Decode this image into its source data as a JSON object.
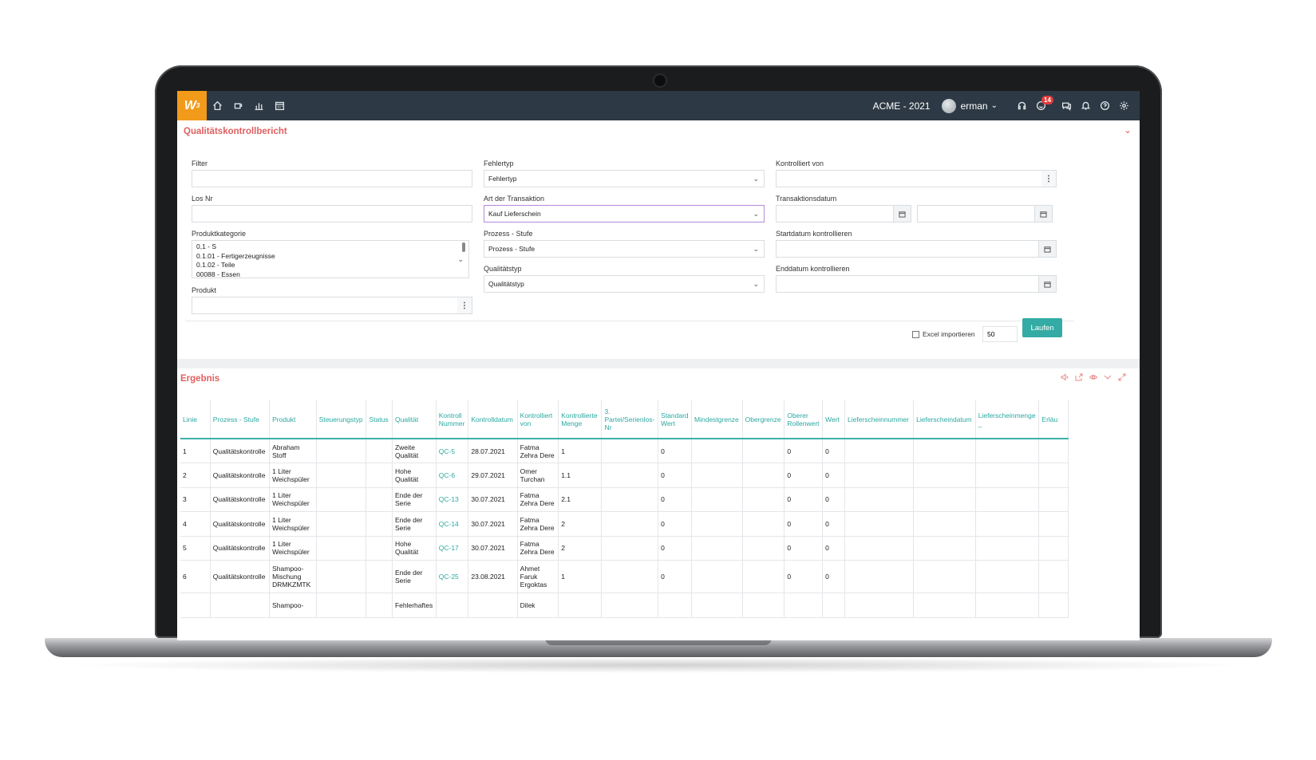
{
  "topbar": {
    "logo": "W",
    "logo_sup": "3",
    "nav": [
      "home-icon",
      "coffee-icon",
      "bar-chart-icon",
      "calendar-icon"
    ],
    "company": "ACME - 2021",
    "user": "erman",
    "notifications_count": "14",
    "right_icons": [
      "headset-icon",
      "smiley-icon",
      "chat-icon",
      "bell-icon",
      "help-icon",
      "gear-icon"
    ]
  },
  "filter_panel": {
    "title": "Qualitätskontrollbericht",
    "filter": {
      "label": "Filter",
      "value": ""
    },
    "los_nr": {
      "label": "Los Nr",
      "value": ""
    },
    "produktkategorie": {
      "label": "Produktkategorie",
      "options": [
        "0,1 - S",
        "0.1.01 - Fertigerzeugnisse",
        "0.1.02 - Teile",
        "00088 - Essen"
      ]
    },
    "produkt": {
      "label": "Produkt",
      "value": ""
    },
    "fehlertyp": {
      "label": "Fehlertyp",
      "value": "Fehlertyp"
    },
    "art_der_transaktion": {
      "label": "Art der Transaktion",
      "value": "Kauf Lieferschein"
    },
    "prozess_stufe": {
      "label": "Prozess - Stufe",
      "value": "Prozess - Stufe"
    },
    "qualitaetstyp": {
      "label": "Qualitätstyp",
      "value": "Qualitätstyp"
    },
    "kontrolliert_von": {
      "label": "Kontrolliert von",
      "value": ""
    },
    "transaktionsdatum": {
      "label": "Transaktionsdatum",
      "from": "",
      "to": ""
    },
    "startdatum": {
      "label": "Startdatum kontrollieren",
      "value": ""
    },
    "enddatum": {
      "label": "Enddatum kontrollieren",
      "value": ""
    },
    "excel_label": "Excel importieren",
    "excel_checked": false,
    "count": "50",
    "run_label": "Laufen"
  },
  "result_panel": {
    "title": "Ergebnis",
    "icons": [
      "speaker-icon",
      "export-icon",
      "eye-icon",
      "chevron-down-icon",
      "expand-icon"
    ],
    "columns": [
      "Linie",
      "Prozess - Stufe",
      "Produkt",
      "Steuerungstyp",
      "Status",
      "Qualität",
      "Kontroll Nummer",
      "Kontrolldatum",
      "Kontrolliert von",
      "Kontrollierte Menge",
      "3. Partei/Serienlos-Nr",
      "Standard Wert",
      "Mindestgrenze",
      "Obergrenze",
      "Oberer Rollenwert",
      "Wert",
      "Lieferscheinnummer",
      "Lieferscheindatum",
      "Lieferscheinmenge _",
      "Erläu"
    ],
    "rows": [
      [
        "1",
        "Qualitätskontrolle",
        "Abraham Stoff",
        "",
        "",
        "Zweite Qualität",
        "QC-5",
        "28.07.2021",
        "Fatma Zehra Dere",
        "1",
        "",
        "0",
        "",
        "",
        "0",
        "0",
        "",
        "",
        "",
        ""
      ],
      [
        "2",
        "Qualitätskontrolle",
        "1 Liter Weichspüler",
        "",
        "",
        "Hohe Qualität",
        "QC-6",
        "29.07.2021",
        "Omer Turchan",
        "1.1",
        "",
        "0",
        "",
        "",
        "0",
        "0",
        "",
        "",
        "",
        ""
      ],
      [
        "3",
        "Qualitätskontrolle",
        "1 Liter Weichspüler",
        "",
        "",
        "Ende der Serie",
        "QC-13",
        "30.07.2021",
        "Fatma Zehra Dere",
        "2.1",
        "",
        "0",
        "",
        "",
        "0",
        "0",
        "",
        "",
        "",
        ""
      ],
      [
        "4",
        "Qualitätskontrolle",
        "1 Liter Weichspüler",
        "",
        "",
        "Ende der Serie",
        "QC-14",
        "30.07.2021",
        "Fatma Zehra Dere",
        "2",
        "",
        "0",
        "",
        "",
        "0",
        "0",
        "",
        "",
        "",
        ""
      ],
      [
        "5",
        "Qualitätskontrolle",
        "1 Liter Weichspüler",
        "",
        "",
        "Hohe Qualität",
        "QC-17",
        "30.07.2021",
        "Fatma Zehra Dere",
        "2",
        "",
        "0",
        "",
        "",
        "0",
        "0",
        "",
        "",
        "",
        ""
      ],
      [
        "6",
        "Qualitätskontrolle",
        "Shampoo-Mischung DRMKZMTK",
        "",
        "",
        "Ende der Serie",
        "QC-25",
        "23.08.2021",
        "Ahmet Faruk Ergoktas",
        "1",
        "",
        "0",
        "",
        "",
        "0",
        "0",
        "",
        "",
        "",
        ""
      ],
      [
        "",
        "",
        "Shampoo-",
        "",
        "",
        "Fehlerhaftes",
        "",
        "",
        "Dilek",
        "",
        "",
        "",
        "",
        "",
        "",
        "",
        "",
        "",
        "",
        ""
      ]
    ]
  },
  "colors": {
    "accent": "#e0605f",
    "teal": "#2aa8a0",
    "topbar": "#2d3a45",
    "logo": "#f29a1a"
  }
}
